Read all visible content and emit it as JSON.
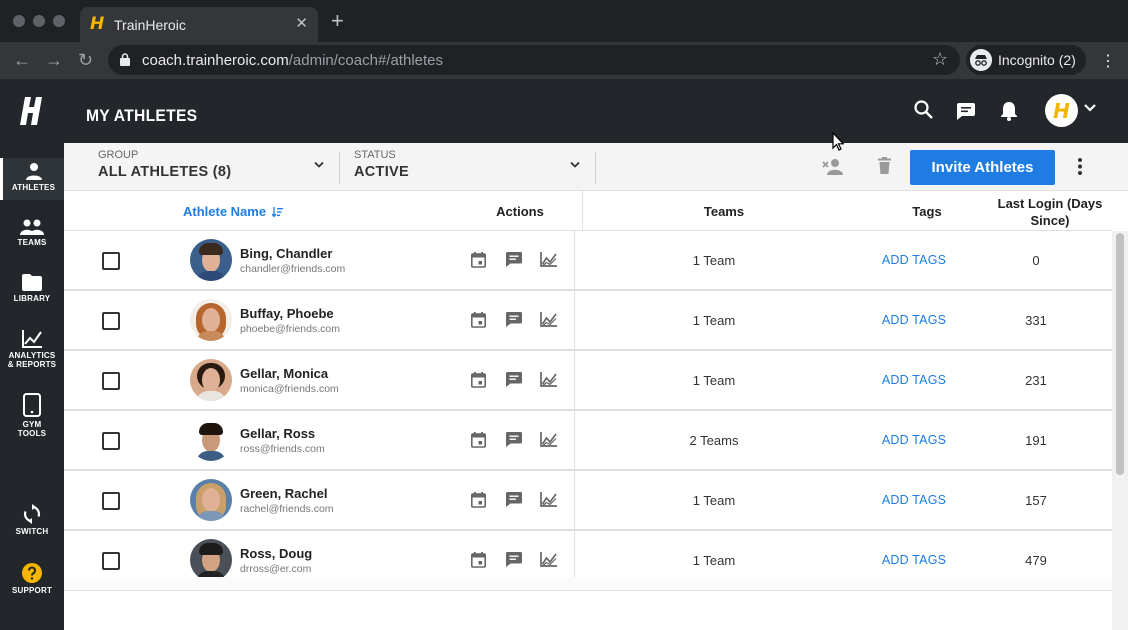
{
  "browser": {
    "tab_title": "TrainHeroic",
    "url_domain": "coach.trainheroic.com",
    "url_path": "/admin/coach#/athletes",
    "incognito_label": "Incognito (2)"
  },
  "sidebar": {
    "items": [
      {
        "label": "ATHLETES",
        "icon": "person-icon"
      },
      {
        "label": "TEAMS",
        "icon": "people-icon"
      },
      {
        "label": "LIBRARY",
        "icon": "folder-icon"
      },
      {
        "label_line1": "ANALYTICS",
        "label_line2": "& REPORTS",
        "icon": "chart-icon"
      },
      {
        "label_line1": "GYM",
        "label_line2": "TOOLS",
        "icon": "tablet-icon"
      },
      {
        "label": "SWITCH",
        "icon": "sync-icon"
      },
      {
        "label": "SUPPORT",
        "icon": "help-icon"
      }
    ]
  },
  "header": {
    "title": "MY ATHLETES",
    "avatar_letter": "H"
  },
  "filters": {
    "group_label": "GROUP",
    "group_value": "ALL ATHLETES (8)",
    "status_label": "STATUS",
    "status_value": "ACTIVE",
    "invite_label": "Invite Athletes"
  },
  "table": {
    "headers": {
      "name": "Athlete Name",
      "actions": "Actions",
      "teams": "Teams",
      "tags": "Tags",
      "last_login_line1": "Last Login (Days",
      "last_login_line2": "Since)"
    },
    "rows": [
      {
        "name": "Bing, Chandler",
        "email": "chandler@friends.com",
        "teams": "1 Team",
        "tags": "ADD TAGS",
        "last_login": "0"
      },
      {
        "name": "Buffay, Phoebe",
        "email": "phoebe@friends.com",
        "teams": "1 Team",
        "tags": "ADD TAGS",
        "last_login": "331"
      },
      {
        "name": "Gellar, Monica",
        "email": "monica@friends.com",
        "teams": "1 Team",
        "tags": "ADD TAGS",
        "last_login": "231"
      },
      {
        "name": "Gellar, Ross",
        "email": "ross@friends.com",
        "teams": "2 Teams",
        "tags": "ADD TAGS",
        "last_login": "191"
      },
      {
        "name": "Green, Rachel",
        "email": "rachel@friends.com",
        "teams": "1 Team",
        "tags": "ADD TAGS",
        "last_login": "157"
      },
      {
        "name": "Ross, Doug",
        "email": "drross@er.com",
        "teams": "1 Team",
        "tags": "ADD TAGS",
        "last_login": "479"
      }
    ]
  },
  "colors": {
    "accent": "#1f7ce3",
    "brand": "#f6b500",
    "header_bg": "#23272b"
  }
}
